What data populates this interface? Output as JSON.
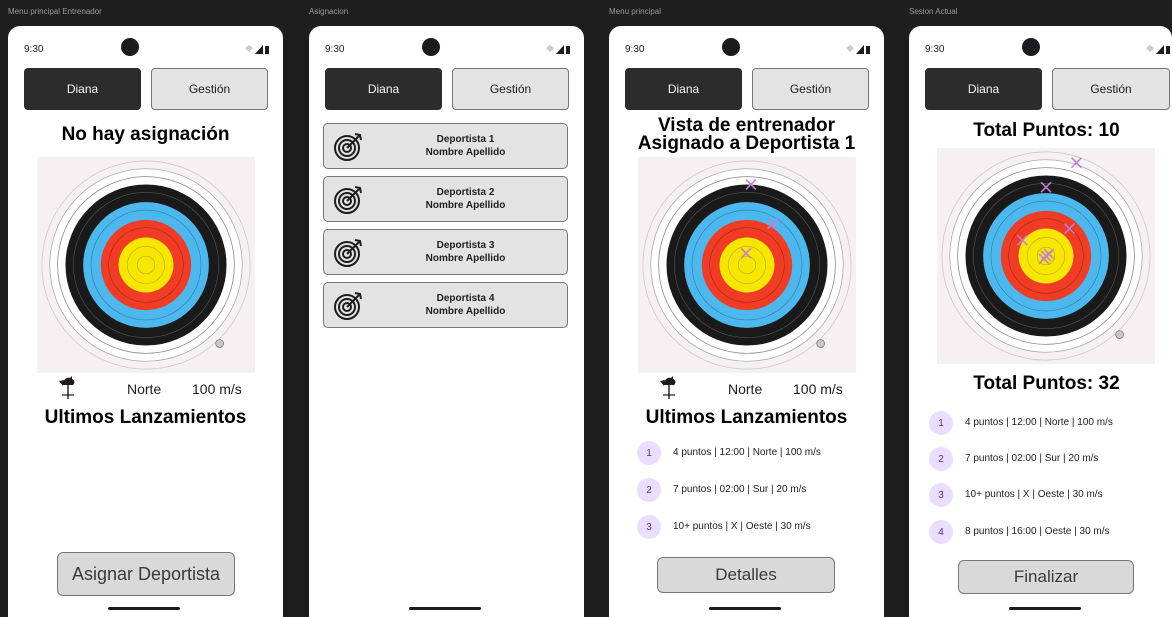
{
  "status": {
    "time": "9:30"
  },
  "tabs": {
    "diana": "Diana",
    "gestion": "Gestión"
  },
  "screen1": {
    "frame_label": "Menu principal Entrenador",
    "title": "No hay asignación",
    "wind_dir": "Norte",
    "wind_speed": "100 m/s",
    "subtitle": "Ultimos Lanzamientos",
    "button": "Asignar Deportista"
  },
  "screen2": {
    "frame_label": "Asignacion",
    "athletes": [
      {
        "name": "Deportista 1",
        "sub": "Nombre Apellido"
      },
      {
        "name": "Deportista 2",
        "sub": "Nombre Apellido"
      },
      {
        "name": "Deportista 3",
        "sub": "Nombre Apellido"
      },
      {
        "name": "Deportista 4",
        "sub": "Nombre Apellido"
      }
    ]
  },
  "screen3": {
    "frame_label": "Menu principal",
    "title_line1": "Vista de entrenador",
    "title_line2": "Asignado a Deportista 1",
    "wind_dir": "Norte",
    "wind_speed": "100 m/s",
    "subtitle": "Ultimos Lanzamientos",
    "shots": [
      {
        "n": "1",
        "text": "4 puntos | 12:00 | Norte | 100 m/s"
      },
      {
        "n": "2",
        "text": "7 puntos | 02:00 | Sur | 20 m/s"
      },
      {
        "n": "3",
        "text": "10+ puntos | X | Oeste | 30 m/s"
      }
    ],
    "button": "Detalles"
  },
  "screen4": {
    "frame_label": "Sesion Actual",
    "title": "Total Puntos: 10",
    "total": "Total Puntos: 32",
    "shots": [
      {
        "n": "1",
        "text": "4 puntos | 12:00 | Norte | 100 m/s"
      },
      {
        "n": "2",
        "text": "7 puntos | 02:00 | Sur | 20 m/s"
      },
      {
        "n": "3",
        "text": "10+ puntos | X | Oeste | 30 m/s"
      },
      {
        "n": "4",
        "text": "8 puntos | 16:00 | Oeste | 30 m/s"
      }
    ],
    "button": "Finalizar"
  },
  "colors": {
    "frame_bg": "#1e1e1e",
    "tab_active": "#2c2c2c",
    "tab_inactive": "#e3e3e3",
    "badge_bg": "#eaddff",
    "target_black": "#1a1a1a",
    "target_blue": "#4db8ee",
    "target_red": "#f03c24",
    "target_yellow": "#f7e600",
    "hit_marker": "#c27fd6"
  },
  "icons": {
    "rooster": "weathervane-icon",
    "target": "target-arrow-icon",
    "hit": "cross-mark-icon"
  }
}
